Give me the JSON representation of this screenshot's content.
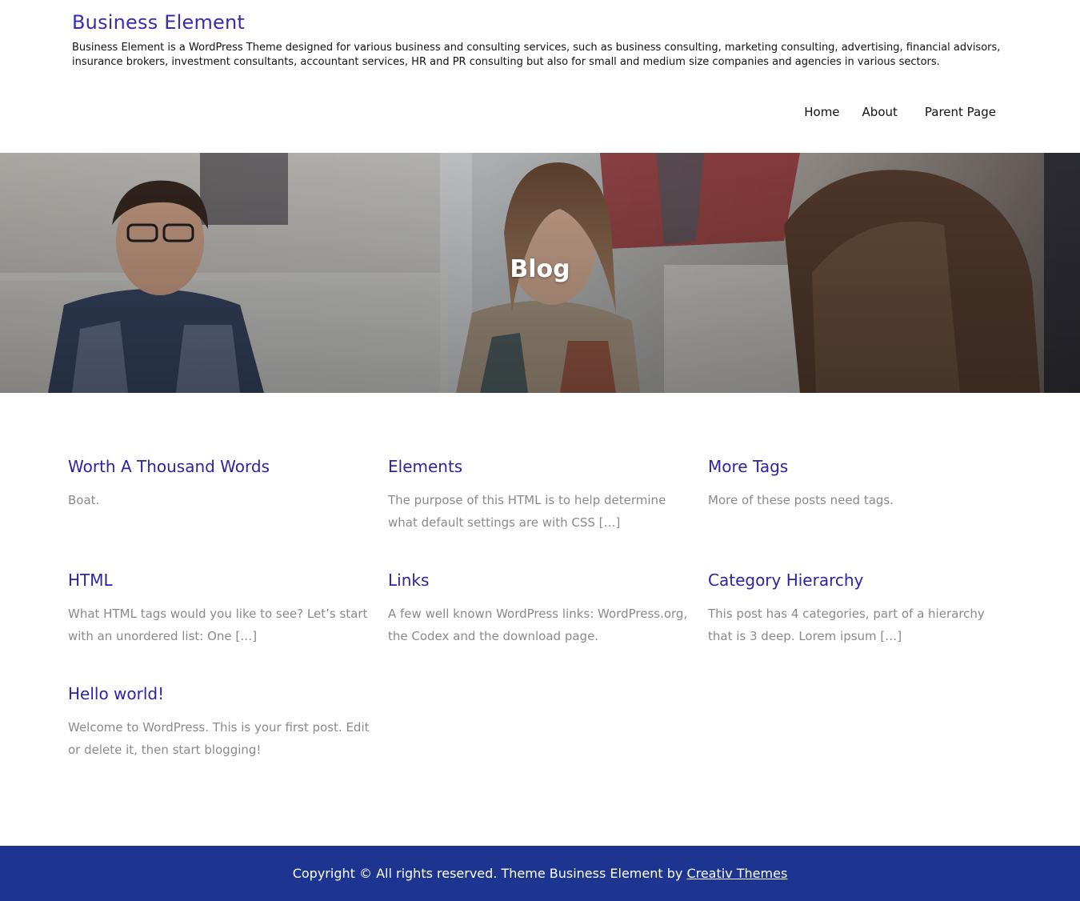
{
  "site": {
    "title": "Business Element",
    "description": "Business Element is a WordPress Theme designed for various business and consulting services, such as business consulting, marketing consulting, advertising, financial advisors, insurance brokers, investment consultants, accountant services, HR and PR consulting but also for small and medium size companies and agencies in various sectors.",
    "brand_color": "#3a2bb5"
  },
  "nav": {
    "items": [
      {
        "label": "Home"
      },
      {
        "label": "About"
      },
      {
        "label": "Parent Page"
      }
    ]
  },
  "hero": {
    "title": "Blog"
  },
  "posts": [
    {
      "title": "Worth A Thousand Words",
      "excerpt": "Boat."
    },
    {
      "title": "Elements",
      "excerpt": "The purpose of this HTML is to help determine what default settings are with CSS […]"
    },
    {
      "title": "More Tags",
      "excerpt": "More of these posts need tags."
    },
    {
      "title": "HTML",
      "excerpt": "What HTML tags would you like to see? Let’s start with an unordered list: One […]"
    },
    {
      "title": "Links",
      "excerpt": "A few well known WordPress links: WordPress.org, the Codex and the download page."
    },
    {
      "title": "Category Hierarchy",
      "excerpt": "This post has 4 categories, part of a hierarchy that is 3 deep. Lorem ipsum […]"
    },
    {
      "title": "Hello world!",
      "excerpt": "Welcome to WordPress. This is your first post. Edit or delete it, then start blogging!"
    }
  ],
  "footer": {
    "text": "Copyright © All rights reserved. Theme Business Element by",
    "link_label": "Creativ Themes",
    "background": "#1d3590"
  }
}
